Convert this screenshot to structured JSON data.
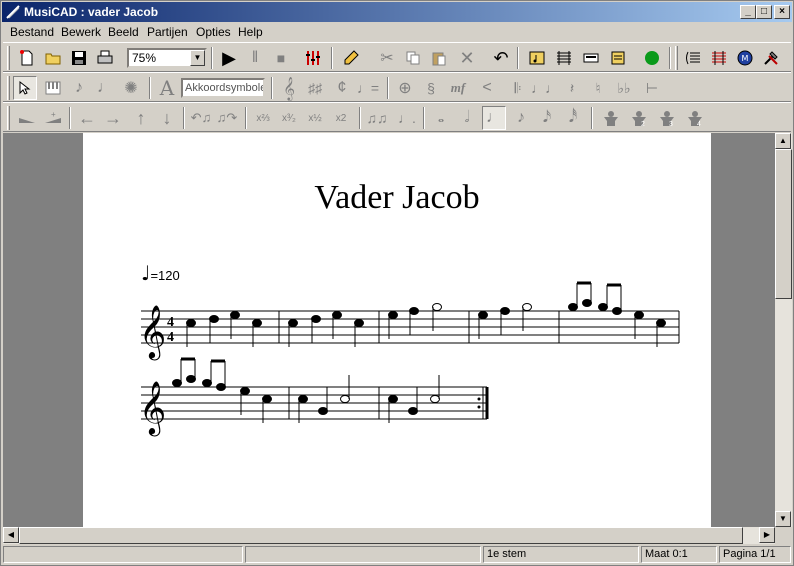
{
  "window": {
    "title": "MusiCAD : vader Jacob",
    "minimize_glyph": "_",
    "maximize_glyph": "□",
    "close_glyph": "×"
  },
  "menu": [
    {
      "label": "Bestand",
      "accel": "B",
      "rest": "estand"
    },
    {
      "label": "Bewerk",
      "accel": "w",
      "rest": ""
    },
    {
      "label": "Beeld",
      "accel": "",
      "rest": ""
    },
    {
      "label": "Partijen",
      "accel": "P",
      "rest": "artijen"
    },
    {
      "label": "Opties",
      "accel": "O",
      "rest": "pties"
    },
    {
      "label": "Help",
      "accel": "H",
      "rest": "elp"
    }
  ],
  "toolbar": {
    "zoom": "75%",
    "chord_placeholder": "Akkoordsymbole",
    "glyphs": {
      "play": "▶",
      "pause": "‖",
      "stop": "■",
      "undo": "↶",
      "record": "●",
      "arrow_left": "←",
      "arrow_right": "→",
      "arrow_up": "↑",
      "arrow_down": "↓",
      "dynamic_mf": "mf",
      "treble": "𝄞",
      "font_a": "A",
      "whole": "𝅝",
      "half": "𝅗𝅥",
      "quarter": "♩",
      "eighth": "♪",
      "sixteenth": "𝅘𝅥𝅯",
      "thirtysecond": "𝅘𝅥𝅰",
      "triplet_x23": "x⅔",
      "triplet_x32": "x³⁄₂",
      "x12": "x½",
      "x2": "x2"
    },
    "colors": {
      "record": "#0a9a1a",
      "text": "#000000"
    }
  },
  "score": {
    "title": "Vader Jacob",
    "tempo_value": "=120",
    "time_signature_top": "4",
    "time_signature_bottom": "4"
  },
  "status": {
    "panel1": "",
    "voice": "1e stem",
    "measure": "Maat 0:1",
    "page": "Pagina 1/1"
  }
}
